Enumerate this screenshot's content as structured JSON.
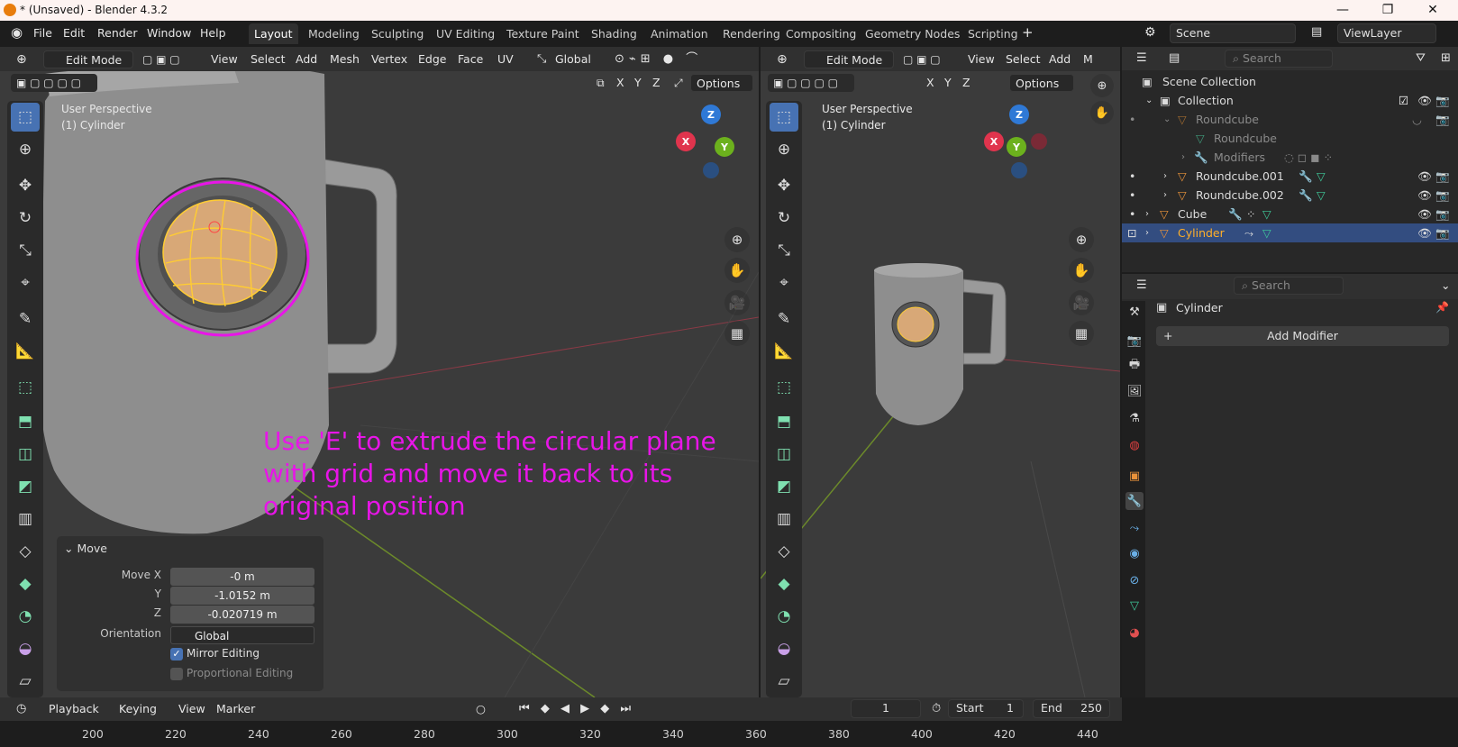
{
  "window": {
    "title": "* (Unsaved) - Blender 4.3.2",
    "minimize": "—",
    "maximize": "❐",
    "close": "✕"
  },
  "menu": [
    "File",
    "Edit",
    "Render",
    "Window",
    "Help"
  ],
  "workspaces": [
    "Layout",
    "Modeling",
    "Sculpting",
    "UV Editing",
    "Texture Paint",
    "Shading",
    "Animation",
    "Rendering",
    "Compositing",
    "Geometry Nodes",
    "Scripting"
  ],
  "active_workspace": "Layout",
  "scene": {
    "name": "Scene",
    "view_layer": "ViewLayer"
  },
  "viewport_left": {
    "mode": "Edit Mode",
    "menus": [
      "View",
      "Select",
      "Add",
      "Mesh",
      "Vertex",
      "Edge",
      "Face",
      "UV"
    ],
    "orientation": "Global",
    "axes": [
      "X",
      "Y",
      "Z"
    ],
    "options": "Options",
    "perspective": "User Perspective",
    "object": "(1) Cylinder"
  },
  "viewport_right": {
    "mode": "Edit Mode",
    "menus": [
      "View",
      "Select",
      "Add",
      "M"
    ],
    "axes": [
      "X",
      "Y",
      "Z"
    ],
    "options": "Options",
    "perspective": "User Perspective",
    "object": "(1) Cylinder"
  },
  "gizmo": {
    "x": "X",
    "y": "Y",
    "z": "Z"
  },
  "annotation": "Use 'E' to extrude the circular plane with grid and move it back to its original position",
  "move_panel": {
    "title": "Move",
    "move_x_label": "Move X",
    "move_x": "-0 m",
    "y_label": "Y",
    "y": "-1.0152 m",
    "z_label": "Z",
    "z": "-0.020719 m",
    "orientation_label": "Orientation",
    "orientation": "Global",
    "mirror_editing": "Mirror Editing",
    "proportional_editing": "Proportional Editing"
  },
  "outliner": {
    "search_placeholder": "Search",
    "rows": [
      {
        "label": "Scene Collection"
      },
      {
        "label": "Collection"
      },
      {
        "label": "Roundcube"
      },
      {
        "label": "Roundcube"
      },
      {
        "label": "Modifiers"
      },
      {
        "label": "Roundcube.001"
      },
      {
        "label": "Roundcube.002"
      },
      {
        "label": "Cube"
      },
      {
        "label": "Cylinder"
      }
    ]
  },
  "properties": {
    "search_placeholder": "Search",
    "object": "Cylinder",
    "add_modifier": "Add Modifier"
  },
  "timeline": {
    "menus": [
      "Playback",
      "Keying",
      "View",
      "Marker"
    ],
    "current_frame": "1",
    "start_label": "Start",
    "start": "1",
    "end_label": "End",
    "end": "250",
    "ticks": [
      "200",
      "220",
      "240",
      "260",
      "280",
      "300",
      "320",
      "340",
      "360",
      "380",
      "400",
      "420",
      "440"
    ]
  },
  "colors": {
    "accent": "#4772b3",
    "selection": "#334d80",
    "annotation": "#e815e8",
    "x_axis": "#e0344d",
    "y_axis": "#6cb11d",
    "z_axis": "#2f79d6"
  }
}
